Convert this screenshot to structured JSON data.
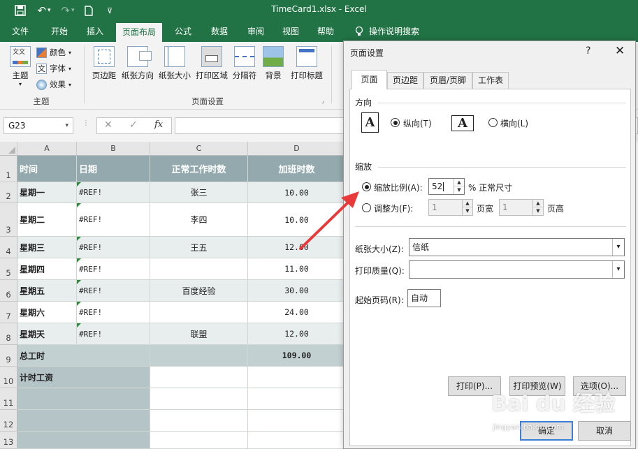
{
  "app": {
    "window_title": "TimeCard1.xlsx - Excel"
  },
  "tabs": [
    "文件",
    "开始",
    "插入",
    "页面布局",
    "公式",
    "数据",
    "审阅",
    "视图",
    "帮助",
    "操作说明搜索"
  ],
  "ribbon": {
    "theme_group": {
      "label": "主题",
      "theme_btn": "主题",
      "colors": "颜色",
      "fonts": "字体",
      "effects": "效果"
    },
    "page_setup_group": {
      "label": "页面设置",
      "buttons": [
        "页边距",
        "纸张方向",
        "纸张大小",
        "打印区域",
        "分隔符",
        "背景",
        "打印标题"
      ]
    }
  },
  "formula_bar": {
    "name_box": "G23",
    "fx": "fx",
    "formula": ""
  },
  "sheet": {
    "columns": [
      "A",
      "B",
      "C",
      "D"
    ],
    "rows": [
      "1",
      "2",
      "3",
      "4",
      "5",
      "6",
      "7",
      "8",
      "9",
      "10",
      "11",
      "12",
      "13"
    ],
    "header": [
      "时间",
      "日期",
      "正常工作时数",
      "加班时数"
    ],
    "data": [
      {
        "day": "星期一",
        "date": "#REF!",
        "normal": "张三",
        "overtime": "10.00"
      },
      {
        "day": "星期二",
        "date": "#REF!",
        "normal": "李四",
        "overtime": "10.00"
      },
      {
        "day": "星期三",
        "date": "#REF!",
        "normal": "王五",
        "overtime": "12.00"
      },
      {
        "day": "星期四",
        "date": "#REF!",
        "normal": "",
        "overtime": "11.00"
      },
      {
        "day": "星期五",
        "date": "#REF!",
        "normal": "百度经验",
        "overtime": "30.00"
      },
      {
        "day": "星期六",
        "date": "#REF!",
        "normal": "",
        "overtime": "24.00"
      },
      {
        "day": "星期天",
        "date": "#REF!",
        "normal": "联盟",
        "overtime": "12.00"
      }
    ],
    "total_label": "总工时",
    "total_value": "109.00",
    "wage_label": "计时工资"
  },
  "dialog": {
    "title": "页面设置",
    "help": "?",
    "close": "✕",
    "tabs": [
      "页面",
      "页边距",
      "页眉/页脚",
      "工作表"
    ],
    "orientation": {
      "label": "方向",
      "portrait": "纵向(T)",
      "landscape": "横向(L)",
      "icon_letter": "A"
    },
    "scaling": {
      "label": "缩放",
      "adjust_label": "缩放比例(A):",
      "adjust_value": "52",
      "adjust_suffix": "% 正常尺寸",
      "fit_label": "调整为(F):",
      "fit_wide": "1",
      "fit_wide_suffix": "页宽",
      "fit_tall": "1",
      "fit_tall_suffix": "页高"
    },
    "paper_size": {
      "label": "纸张大小(Z):",
      "value": "信纸"
    },
    "print_quality": {
      "label": "打印质量(Q):",
      "value": ""
    },
    "first_page": {
      "label": "起始页码(R):",
      "value": "自动"
    },
    "buttons": {
      "print": "打印(P)...",
      "preview": "打印预览(W)",
      "options": "选项(O)...",
      "ok": "确定",
      "cancel": "取消"
    }
  },
  "watermark": {
    "main": "Bai du 经验",
    "sub": "jingyan.baidu.com"
  },
  "colors": {
    "excel_green": "#217346",
    "header_fill": "#93a9ad",
    "alt_row": "#e8edee",
    "arrow": "#e83a3a"
  }
}
